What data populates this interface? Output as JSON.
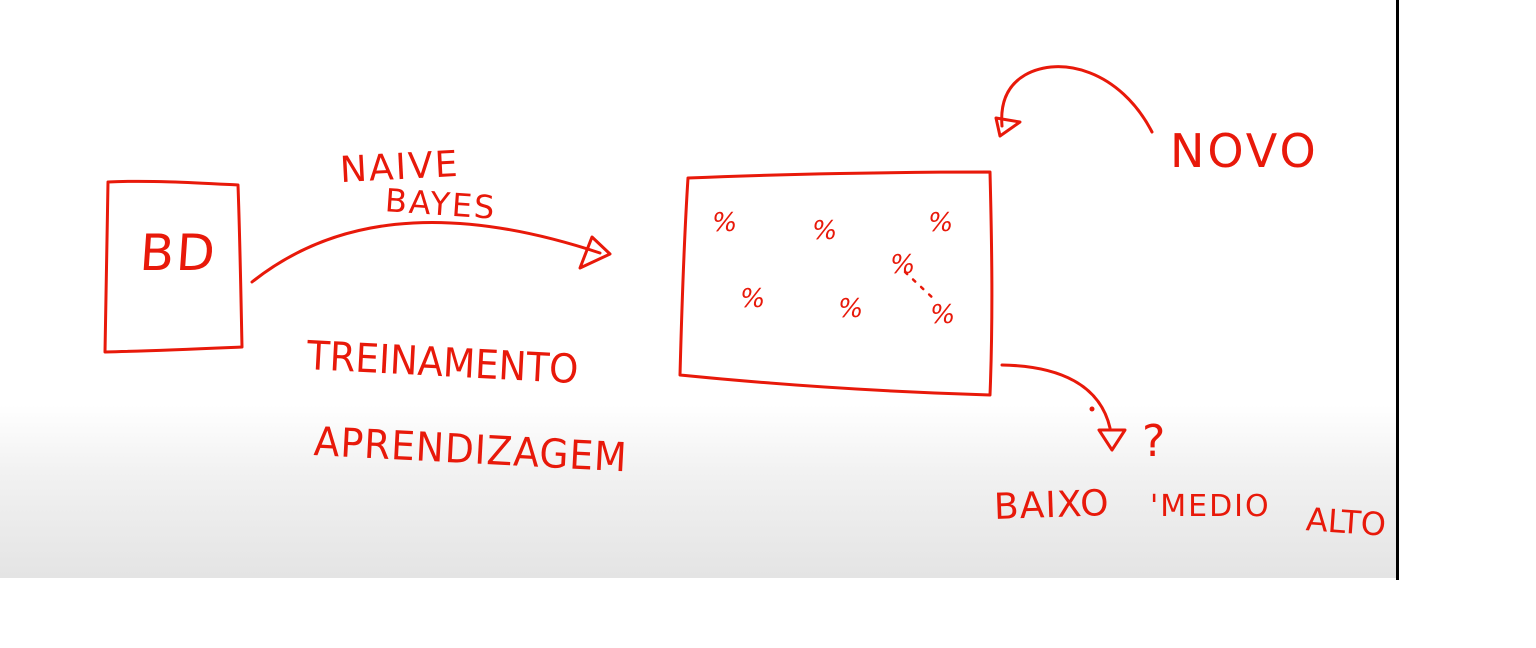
{
  "colors": {
    "ink": "#e8190a",
    "board_edge": "#000000",
    "background": "#ffffff"
  },
  "diagram": {
    "database_label": "BD",
    "algorithm_label_line1": "NAIVE",
    "algorithm_label_line2": "BAYES",
    "process_label_1": "TREINAMENTO",
    "process_label_2": "APRENDIZAGEM",
    "model_cells": [
      "%",
      "%",
      "%",
      "%",
      "%",
      "%",
      "%"
    ],
    "new_input_label": "NOVO",
    "prediction_label": "?",
    "classes": [
      "BAIXO",
      "'MEDIO",
      "ALTO"
    ]
  }
}
